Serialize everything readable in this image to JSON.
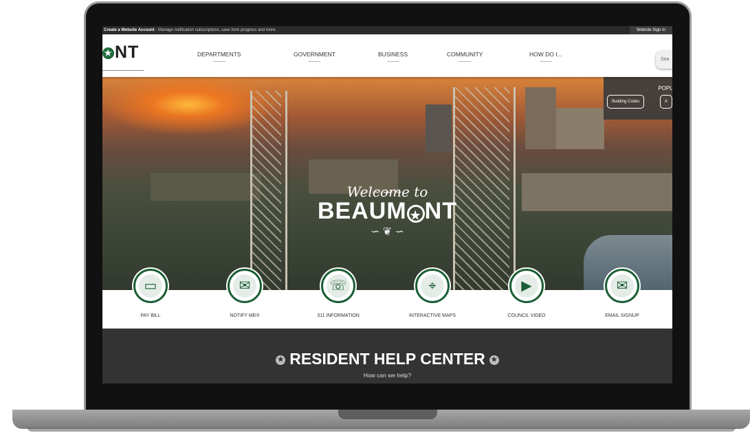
{
  "topbar": {
    "account_link": "Create a Website Account",
    "account_text": " - Manage notification subscriptions, save form progress and more.",
    "signin": "Website Sign In"
  },
  "header": {
    "logo_text": "NT",
    "logo_star": "★",
    "nav": [
      "DEPARTMENTS",
      "GOVERNMENT",
      "BUSINESS",
      "COMMUNITY",
      "HOW DO I..."
    ],
    "search_placeholder": "Sea"
  },
  "popular": {
    "title": "POPU",
    "chips": [
      "Building Codes",
      "A"
    ]
  },
  "hero": {
    "welcome_script": "Welcome to",
    "city_part1": "BEAUM",
    "city_star": "★",
    "city_part2": "NT",
    "flourish_top": "~ ∽ ~",
    "flourish_bottom": "∽ ❦ ∽"
  },
  "quick_links": [
    {
      "label": "PAY BILL",
      "icon": "credit-card-icon",
      "glyph": "▭"
    },
    {
      "label": "NOTIFY ME®",
      "icon": "notify-phone-icon",
      "glyph": "✉"
    },
    {
      "label": "311 INFORMATION",
      "icon": "chat-bubbles-icon",
      "glyph": "☏"
    },
    {
      "label": "INTERACTIVE MAPS",
      "icon": "map-pin-icon",
      "glyph": "⌖"
    },
    {
      "label": "COUNCIL VIDEO",
      "icon": "video-camera-icon",
      "glyph": "▶"
    },
    {
      "label": "EMAIL SIGNUP",
      "icon": "envelope-icon",
      "glyph": "✉"
    }
  ],
  "help_center": {
    "title": "RESIDENT HELP CENTER",
    "star": "★",
    "subtitle": "How can we help?"
  },
  "colors": {
    "brand_green": "#1b5e35",
    "dark_band": "#333333"
  }
}
